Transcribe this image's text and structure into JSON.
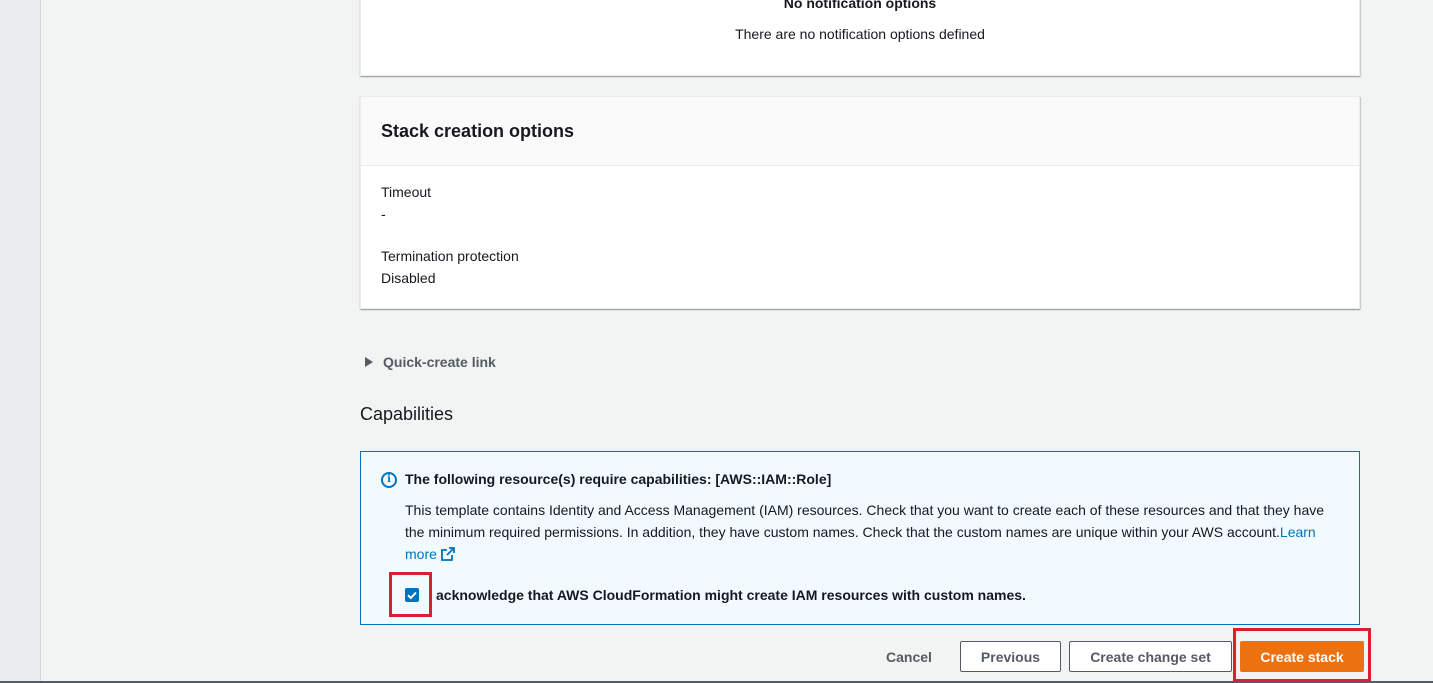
{
  "notifications": {
    "title": "No notification options",
    "description": "There are no notification options defined"
  },
  "stack_creation_options": {
    "title": "Stack creation options",
    "fields": [
      {
        "label": "Timeout",
        "value": "-"
      },
      {
        "label": "Termination protection",
        "value": "Disabled"
      }
    ]
  },
  "quick_create": {
    "label": "Quick-create link",
    "expanded": false
  },
  "capabilities": {
    "title": "Capabilities",
    "info_title": "The following resource(s) require capabilities: [AWS::IAM::Role]",
    "info_body": "This template contains Identity and Access Management (IAM) resources. Check that you want to create each of these resources and that they have the minimum required permissions. In addition, they have custom names. Check that the custom names are unique within your AWS account.",
    "learn_more": "Learn more",
    "acknowledge_label": "acknowledge that AWS CloudFormation might create IAM resources with custom names.",
    "acknowledge_checked": true
  },
  "footer": {
    "cancel": "Cancel",
    "previous": "Previous",
    "create_change_set": "Create change set",
    "create_stack": "Create stack"
  },
  "colors": {
    "primary": "#ec7211",
    "link": "#0073bb",
    "info_bg": "#f1faff",
    "highlight": "#dd1e2e"
  }
}
